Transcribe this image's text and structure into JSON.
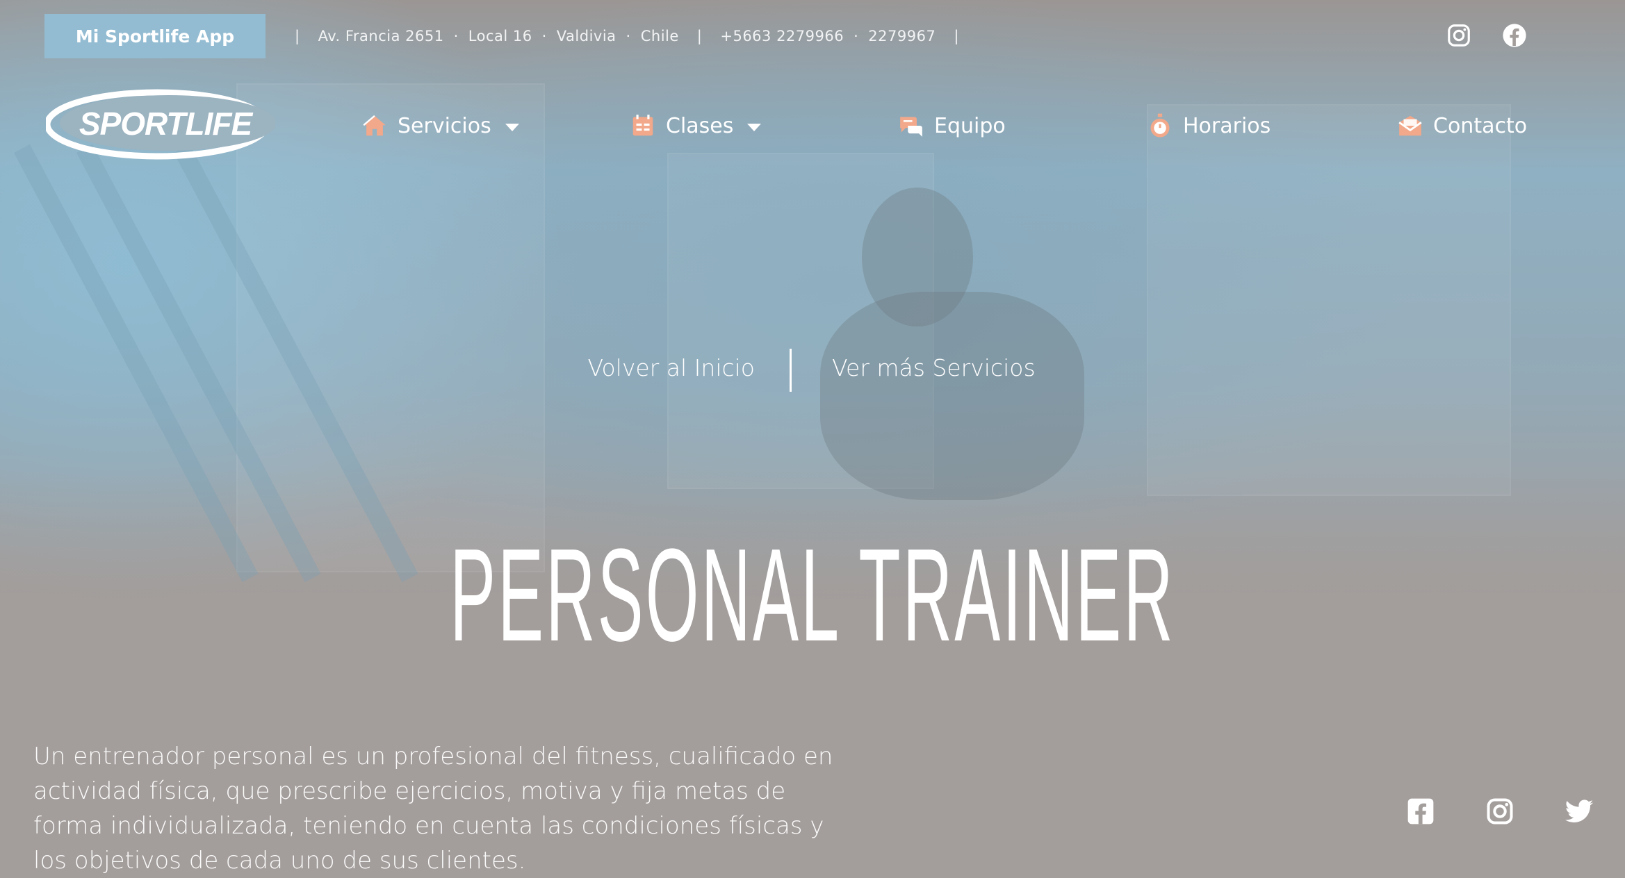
{
  "topbar": {
    "app_button": "Mi Sportlife App",
    "sep": "|",
    "dot": "·",
    "address": [
      "Av. Francia 2651",
      "Local 16",
      "Valdivia",
      "Chile"
    ],
    "phones": [
      "+5663 2279966",
      "2279967"
    ],
    "social_icons": [
      "instagram-icon",
      "facebook-icon"
    ]
  },
  "logo": {
    "text": "SPORTLIFE"
  },
  "nav": {
    "items": [
      {
        "label": "Servicios",
        "icon": "house-icon",
        "dropdown": true
      },
      {
        "label": "Clases",
        "icon": "calendar-icon",
        "dropdown": true
      },
      {
        "label": "Equipo",
        "icon": "chat-bubbles-icon",
        "dropdown": false
      },
      {
        "label": "Horarios",
        "icon": "stopwatch-icon",
        "dropdown": false
      },
      {
        "label": "Contacto",
        "icon": "envelope-icon",
        "dropdown": false
      }
    ],
    "icon_color": "#f2a88a"
  },
  "hero": {
    "link_home": "Volver al Inicio",
    "link_services": "Ver más Servicios",
    "title": "PERSONAL TRAINER"
  },
  "content": {
    "description": "Un entrenador personal es un profesional del fitness, cualificado en actividad física, que prescribe ejercicios, motiva y fija metas de forma individualizada, teniendo en cuenta las condiciones físicas y los objetivos de cada uno de sus clientes."
  },
  "footer_social": [
    "facebook-square-icon",
    "instagram-icon",
    "twitter-icon"
  ],
  "colors": {
    "accent": "#93bcd2",
    "background": "#a39d9b"
  }
}
